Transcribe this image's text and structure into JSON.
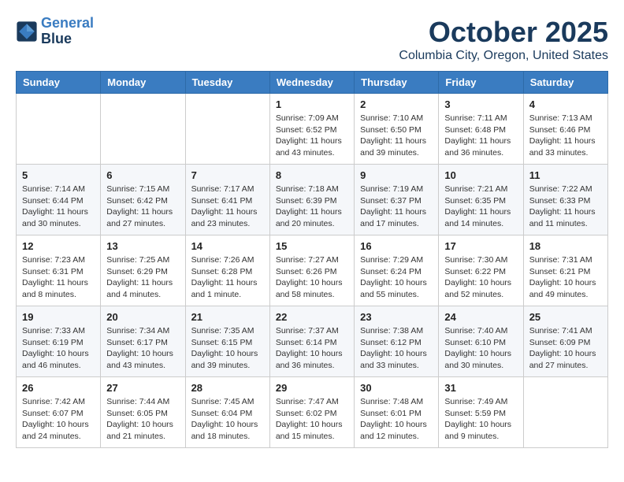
{
  "logo": {
    "line1": "General",
    "line2": "Blue"
  },
  "title": "October 2025",
  "location": "Columbia City, Oregon, United States",
  "days_of_week": [
    "Sunday",
    "Monday",
    "Tuesday",
    "Wednesday",
    "Thursday",
    "Friday",
    "Saturday"
  ],
  "weeks": [
    [
      {
        "day": "",
        "sunrise": "",
        "sunset": "",
        "daylight": ""
      },
      {
        "day": "",
        "sunrise": "",
        "sunset": "",
        "daylight": ""
      },
      {
        "day": "",
        "sunrise": "",
        "sunset": "",
        "daylight": ""
      },
      {
        "day": "1",
        "sunrise": "Sunrise: 7:09 AM",
        "sunset": "Sunset: 6:52 PM",
        "daylight": "Daylight: 11 hours and 43 minutes."
      },
      {
        "day": "2",
        "sunrise": "Sunrise: 7:10 AM",
        "sunset": "Sunset: 6:50 PM",
        "daylight": "Daylight: 11 hours and 39 minutes."
      },
      {
        "day": "3",
        "sunrise": "Sunrise: 7:11 AM",
        "sunset": "Sunset: 6:48 PM",
        "daylight": "Daylight: 11 hours and 36 minutes."
      },
      {
        "day": "4",
        "sunrise": "Sunrise: 7:13 AM",
        "sunset": "Sunset: 6:46 PM",
        "daylight": "Daylight: 11 hours and 33 minutes."
      }
    ],
    [
      {
        "day": "5",
        "sunrise": "Sunrise: 7:14 AM",
        "sunset": "Sunset: 6:44 PM",
        "daylight": "Daylight: 11 hours and 30 minutes."
      },
      {
        "day": "6",
        "sunrise": "Sunrise: 7:15 AM",
        "sunset": "Sunset: 6:42 PM",
        "daylight": "Daylight: 11 hours and 27 minutes."
      },
      {
        "day": "7",
        "sunrise": "Sunrise: 7:17 AM",
        "sunset": "Sunset: 6:41 PM",
        "daylight": "Daylight: 11 hours and 23 minutes."
      },
      {
        "day": "8",
        "sunrise": "Sunrise: 7:18 AM",
        "sunset": "Sunset: 6:39 PM",
        "daylight": "Daylight: 11 hours and 20 minutes."
      },
      {
        "day": "9",
        "sunrise": "Sunrise: 7:19 AM",
        "sunset": "Sunset: 6:37 PM",
        "daylight": "Daylight: 11 hours and 17 minutes."
      },
      {
        "day": "10",
        "sunrise": "Sunrise: 7:21 AM",
        "sunset": "Sunset: 6:35 PM",
        "daylight": "Daylight: 11 hours and 14 minutes."
      },
      {
        "day": "11",
        "sunrise": "Sunrise: 7:22 AM",
        "sunset": "Sunset: 6:33 PM",
        "daylight": "Daylight: 11 hours and 11 minutes."
      }
    ],
    [
      {
        "day": "12",
        "sunrise": "Sunrise: 7:23 AM",
        "sunset": "Sunset: 6:31 PM",
        "daylight": "Daylight: 11 hours and 8 minutes."
      },
      {
        "day": "13",
        "sunrise": "Sunrise: 7:25 AM",
        "sunset": "Sunset: 6:29 PM",
        "daylight": "Daylight: 11 hours and 4 minutes."
      },
      {
        "day": "14",
        "sunrise": "Sunrise: 7:26 AM",
        "sunset": "Sunset: 6:28 PM",
        "daylight": "Daylight: 11 hours and 1 minute."
      },
      {
        "day": "15",
        "sunrise": "Sunrise: 7:27 AM",
        "sunset": "Sunset: 6:26 PM",
        "daylight": "Daylight: 10 hours and 58 minutes."
      },
      {
        "day": "16",
        "sunrise": "Sunrise: 7:29 AM",
        "sunset": "Sunset: 6:24 PM",
        "daylight": "Daylight: 10 hours and 55 minutes."
      },
      {
        "day": "17",
        "sunrise": "Sunrise: 7:30 AM",
        "sunset": "Sunset: 6:22 PM",
        "daylight": "Daylight: 10 hours and 52 minutes."
      },
      {
        "day": "18",
        "sunrise": "Sunrise: 7:31 AM",
        "sunset": "Sunset: 6:21 PM",
        "daylight": "Daylight: 10 hours and 49 minutes."
      }
    ],
    [
      {
        "day": "19",
        "sunrise": "Sunrise: 7:33 AM",
        "sunset": "Sunset: 6:19 PM",
        "daylight": "Daylight: 10 hours and 46 minutes."
      },
      {
        "day": "20",
        "sunrise": "Sunrise: 7:34 AM",
        "sunset": "Sunset: 6:17 PM",
        "daylight": "Daylight: 10 hours and 43 minutes."
      },
      {
        "day": "21",
        "sunrise": "Sunrise: 7:35 AM",
        "sunset": "Sunset: 6:15 PM",
        "daylight": "Daylight: 10 hours and 39 minutes."
      },
      {
        "day": "22",
        "sunrise": "Sunrise: 7:37 AM",
        "sunset": "Sunset: 6:14 PM",
        "daylight": "Daylight: 10 hours and 36 minutes."
      },
      {
        "day": "23",
        "sunrise": "Sunrise: 7:38 AM",
        "sunset": "Sunset: 6:12 PM",
        "daylight": "Daylight: 10 hours and 33 minutes."
      },
      {
        "day": "24",
        "sunrise": "Sunrise: 7:40 AM",
        "sunset": "Sunset: 6:10 PM",
        "daylight": "Daylight: 10 hours and 30 minutes."
      },
      {
        "day": "25",
        "sunrise": "Sunrise: 7:41 AM",
        "sunset": "Sunset: 6:09 PM",
        "daylight": "Daylight: 10 hours and 27 minutes."
      }
    ],
    [
      {
        "day": "26",
        "sunrise": "Sunrise: 7:42 AM",
        "sunset": "Sunset: 6:07 PM",
        "daylight": "Daylight: 10 hours and 24 minutes."
      },
      {
        "day": "27",
        "sunrise": "Sunrise: 7:44 AM",
        "sunset": "Sunset: 6:05 PM",
        "daylight": "Daylight: 10 hours and 21 minutes."
      },
      {
        "day": "28",
        "sunrise": "Sunrise: 7:45 AM",
        "sunset": "Sunset: 6:04 PM",
        "daylight": "Daylight: 10 hours and 18 minutes."
      },
      {
        "day": "29",
        "sunrise": "Sunrise: 7:47 AM",
        "sunset": "Sunset: 6:02 PM",
        "daylight": "Daylight: 10 hours and 15 minutes."
      },
      {
        "day": "30",
        "sunrise": "Sunrise: 7:48 AM",
        "sunset": "Sunset: 6:01 PM",
        "daylight": "Daylight: 10 hours and 12 minutes."
      },
      {
        "day": "31",
        "sunrise": "Sunrise: 7:49 AM",
        "sunset": "Sunset: 5:59 PM",
        "daylight": "Daylight: 10 hours and 9 minutes."
      },
      {
        "day": "",
        "sunrise": "",
        "sunset": "",
        "daylight": ""
      }
    ]
  ]
}
